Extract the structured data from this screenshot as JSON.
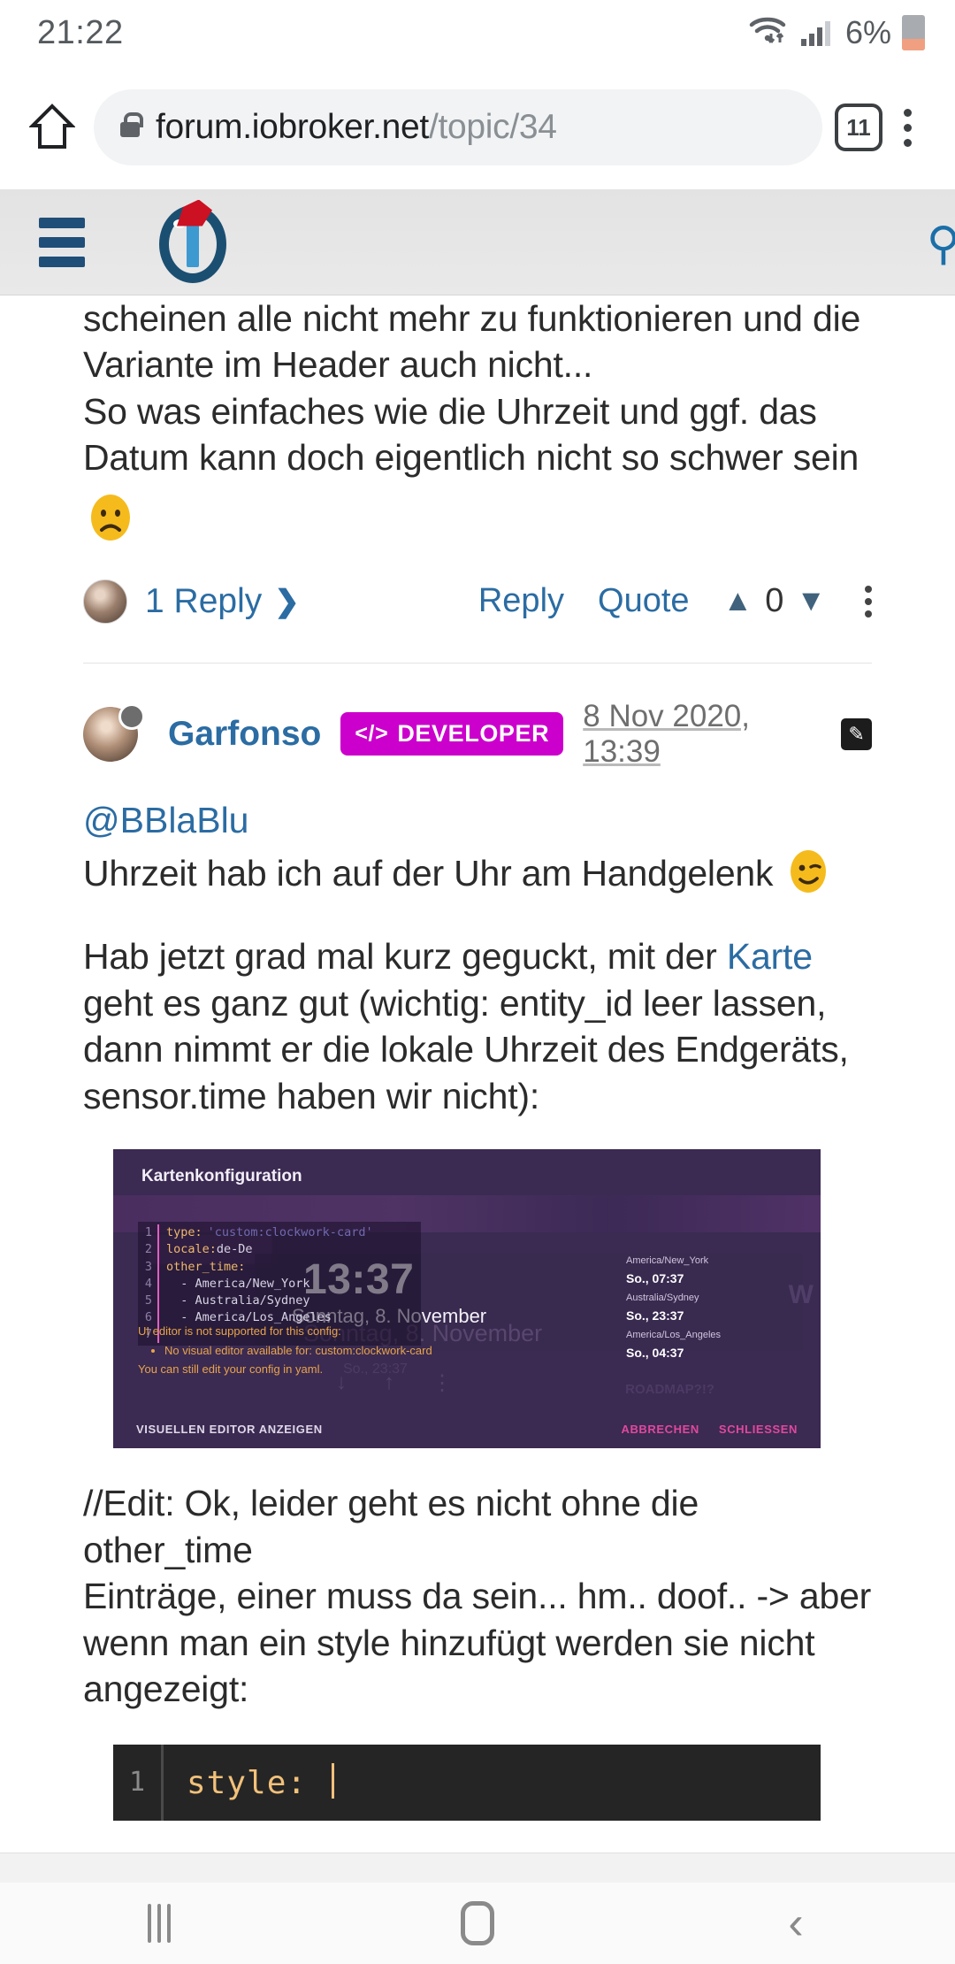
{
  "statusbar": {
    "clock": "21:22",
    "battery_percent": "6%",
    "wifi_icon": "wifi-icon",
    "signal_icon": "cellular-signal-icon",
    "battery_icon": "battery-low-icon",
    "battery_color": "#f0a080"
  },
  "browser": {
    "home_icon": "home-icon",
    "lock_icon": "lock-icon",
    "url_domain": "forum.iobroker.net",
    "url_path": "/topic/34",
    "tab_count": "11",
    "menu_icon": "overflow-menu-icon"
  },
  "forum_header": {
    "menu_icon": "hamburger-menu-icon",
    "logo_icon": "iobroker-logo-icon",
    "search_icon": "search-icon",
    "brand_color": "#1b4f72"
  },
  "post_previous": {
    "body_lines": [
      "scheinen alle nicht mehr zu funktionieren und die",
      "Variante im Header auch nicht...",
      "So was einfaches wie die Uhrzeit und ggf. das",
      "Datum kann doch eigentlich nicht so schwer sein"
    ],
    "emoji": "☹",
    "actions": {
      "replies_label": "1 Reply",
      "replies_chevron": "❯",
      "reply_label": "Reply",
      "quote_label": "Quote",
      "vote_up_icon": "chevron-up-icon",
      "vote_count": "0",
      "vote_down_icon": "chevron-down-icon",
      "more_icon": "post-more-icon"
    }
  },
  "post_current": {
    "avatar": "user-avatar",
    "username": "Garfonso",
    "badge_code_icon": "</>",
    "badge_label": "DEVELOPER",
    "timestamp": "8 Nov 2020, 13:39",
    "edit_icon": "pencil-icon",
    "mention": "@BBlaBlu",
    "line_1": "Uhrzeit hab ich auf der Uhr am Handgelenk",
    "emoji_wink": "😉",
    "para2_pre": "Hab jetzt grad mal kurz geguckt, mit der ",
    "para2_link": "Karte",
    "para2_rest_1": "geht es ganz gut (wichtig: entity_id leer lassen,",
    "para2_rest_2": "dann nimmt er die lokale Uhrzeit des Endgeräts,",
    "para2_rest_3": "sensor.time haben wir nicht):",
    "para3_lines": [
      "//Edit: Ok, leider geht es nicht ohne die other_time",
      "Einträge, einer muss da sein... hm.. doof.. -> aber",
      "wenn man ein style hinzufügt werden sie nicht",
      "angezeigt:"
    ],
    "link_color": "#2b6ca3",
    "badge_color": "#cc00cc"
  },
  "embedded_screenshot": {
    "dialog_title": "Kartenkonfiguration",
    "yaml_lines": [
      {
        "num": "1",
        "key": "type:",
        "value": "",
        "string": "'custom:clockwork-card'"
      },
      {
        "num": "2",
        "key": "locale:",
        "value": " de-De",
        "string": ""
      },
      {
        "num": "3",
        "key": "other_time:",
        "value": "",
        "string": ""
      },
      {
        "num": "4",
        "key": "",
        "value": "  - America/New_York",
        "string": ""
      },
      {
        "num": "5",
        "key": "",
        "value": "  - Australia/Sydney",
        "string": ""
      },
      {
        "num": "6",
        "key": "",
        "value": "  - America/Los_Angeles",
        "string": ""
      },
      {
        "num": "7",
        "key": "",
        "value": "",
        "string": ""
      }
    ],
    "warning_title": "UI editor is not supported for this config:",
    "warning_bullet": "No visual editor available for: custom:clockwork-card",
    "warning_footer": "You can still edit your config in yaml.",
    "clock_time": "13:37",
    "clock_date": "Sonntag, 8. November",
    "ghost_date": "Sonntag, 8. November",
    "timezones": [
      {
        "name": "America/New_York",
        "time": "So., 07:37"
      },
      {
        "name": "Australia/Sydney",
        "time": "So., 23:37"
      },
      {
        "name": "America/Los_Angeles",
        "time": "So., 04:37"
      }
    ],
    "footer_show_editor": "VISUELLEN EDITOR ANZEIGEN",
    "footer_cancel": "ABBRECHEN",
    "footer_close": "SCHLIESSEN",
    "ghost_row_text": "So., 23:37",
    "ghost_roadmap": "ROADMAP?!?",
    "ghost_w": "W",
    "accent_pink": "#e0489f",
    "bg_color": "#3b2a52"
  },
  "code_block": {
    "line_number": "1",
    "code": "style:",
    "caret": "|"
  },
  "navbar": {
    "recents_icon": "recents-icon",
    "home_icon": "home-icon",
    "back_icon": "back-icon"
  }
}
